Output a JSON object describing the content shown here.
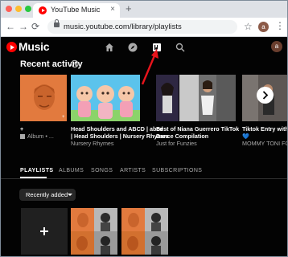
{
  "browser": {
    "tab_title": "YouTube Music",
    "tab_close": "×",
    "new_tab": "+",
    "url": "music.youtube.com/library/playlists",
    "profile_initial": "a",
    "traffic_lights": [
      "#fe5f57",
      "#febc2e",
      "#28c840"
    ]
  },
  "app": {
    "logo_text": "Music",
    "avatar_initial": "a",
    "brand_color": "#ff0000",
    "nav_icons": [
      "home-icon",
      "explore-icon",
      "library-icon",
      "search-icon"
    ]
  },
  "recent": {
    "title": "Recent activity",
    "items": [
      {
        "title": "+",
        "subtitle": "Album • ..."
      },
      {
        "title": "Head Shoulders and ABCD | abcd | Head Shoulders | Nursery Rhymes",
        "title_line1": "Head Shoulders and ABCD | abcd",
        "title_line2": "| Head Shoulders | Nursery Rhymes",
        "subtitle": "Nursery Rhymes"
      },
      {
        "title_line1": "Best of Niana Guerrero TikTok",
        "title_line2": "Dance Compilation",
        "subtitle": "Just for Funzies"
      },
      {
        "title_line1": "",
        "subtitle": ""
      },
      {
        "title_line1": "Tiktok Entry with Ty",
        "title_line2": "💙",
        "subtitle": "MOMMY TONI FOW"
      }
    ]
  },
  "library": {
    "tabs": [
      "PLAYLISTS",
      "ALBUMS",
      "SONGS",
      "ARTISTS",
      "SUBSCRIPTIONS"
    ],
    "active_tab": "PLAYLISTS",
    "sort_label": "Recently added"
  },
  "annotation": {
    "arrow_color": "#e8141c"
  }
}
